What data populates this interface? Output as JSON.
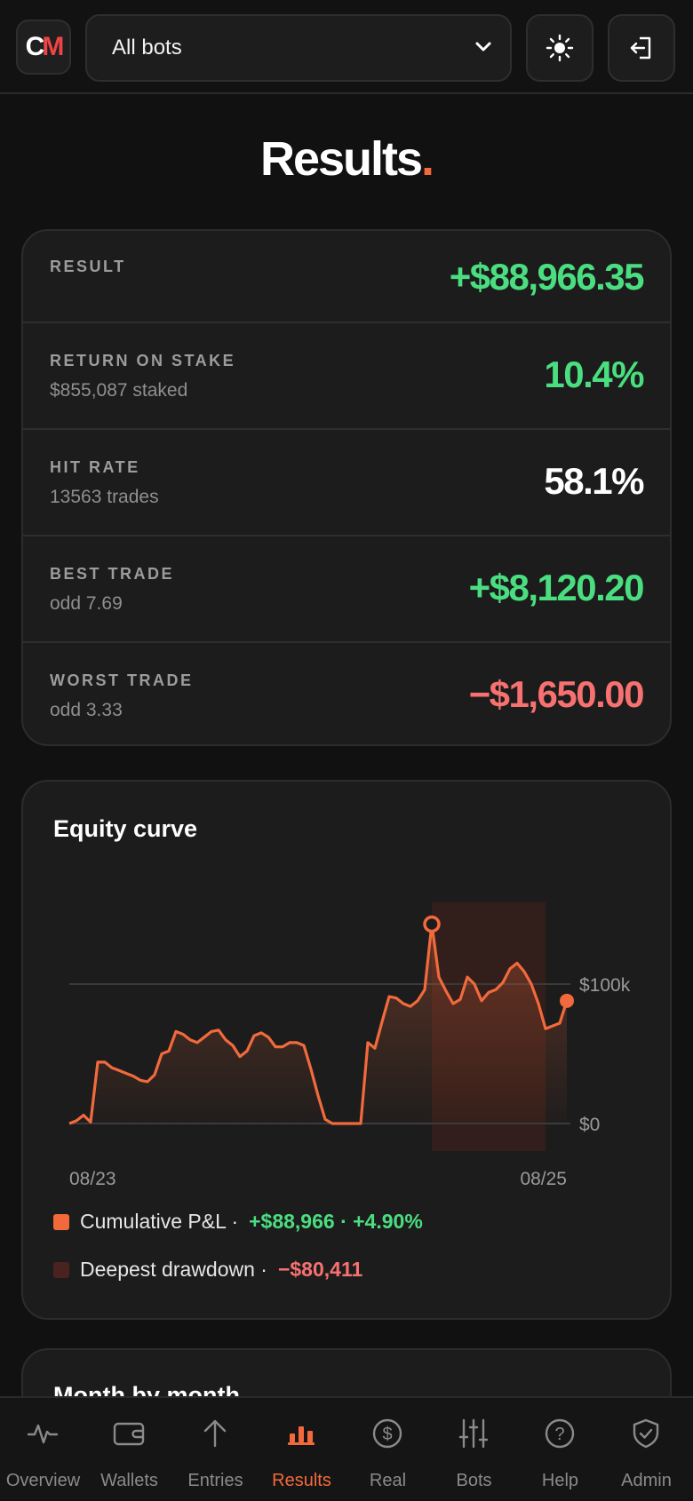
{
  "header": {
    "logo_text_c": "C",
    "logo_text_m": "M",
    "bot_select_value": "All bots",
    "theme_icon": "sun-icon",
    "logout_icon": "logout-icon"
  },
  "page": {
    "title": "Results",
    "title_dot": "."
  },
  "stats": [
    {
      "label": "RESULT",
      "sub": "",
      "value": "+$88,966.35",
      "tone": "pos"
    },
    {
      "label": "RETURN ON STAKE",
      "sub": "$855,087 staked",
      "value": "10.4%",
      "tone": "pos"
    },
    {
      "label": "HIT RATE",
      "sub": "13563 trades",
      "value": "58.1%",
      "tone": "neu"
    },
    {
      "label": "BEST TRADE",
      "sub": "odd 7.69",
      "value": "+$8,120.20",
      "tone": "pos"
    },
    {
      "label": "WORST TRADE",
      "sub": "odd 3.33",
      "value": "−$1,650.00",
      "tone": "neg"
    }
  ],
  "equity": {
    "title": "Equity curve",
    "legend_pnl_label": "Cumulative P&L ·",
    "legend_pnl_value": "+$88,966 · +4.90%",
    "legend_dd_label": "Deepest drawdown ·",
    "legend_dd_value": "−$80,411",
    "colors": {
      "line": "#f26a3c",
      "drawdown": "#3a1f1a",
      "positive": "#4ade80",
      "negative": "#f87171"
    }
  },
  "chart_data": {
    "type": "line",
    "x_tick_labels": [
      "08/23",
      "08/25"
    ],
    "y_tick_labels": [
      "$100k",
      "$0"
    ],
    "y_ticks": [
      100000,
      0
    ],
    "ylim": [
      -15000,
      160000
    ],
    "grid": true,
    "series": [
      {
        "values": [
          0,
          2000,
          6000,
          1000,
          44000,
          44000,
          40000,
          38000,
          36000,
          34000,
          31000,
          30000,
          35000,
          50000,
          52000,
          66000,
          64000,
          60000,
          58000,
          62000,
          66000,
          67000,
          60000,
          56000,
          48000,
          52000,
          63000,
          65000,
          62000,
          55000,
          55000,
          58000,
          58000,
          56000,
          39000,
          20000,
          3000,
          0,
          0,
          0,
          0,
          0,
          58000,
          54000,
          73000,
          91000,
          90000,
          86000,
          84000,
          88000,
          96000,
          112000,
          105000,
          95000,
          86000,
          89000,
          105000,
          100000,
          88000,
          94000,
          96000,
          101000,
          111000,
          115000,
          109000,
          100000,
          86000,
          68000,
          70000,
          72000,
          88000
        ]
      }
    ],
    "peak_index": 51,
    "peak_value": 143000,
    "drawdown_start_index": 51,
    "drawdown_end_index": 67,
    "last_value": 88966
  },
  "nav": [
    {
      "label": "Overview",
      "icon": "activity-icon",
      "active": false
    },
    {
      "label": "Wallets",
      "icon": "wallet-icon",
      "active": false
    },
    {
      "label": "Entries",
      "icon": "arrow-up-icon",
      "active": false
    },
    {
      "label": "Results",
      "icon": "bar-chart-icon",
      "active": true
    },
    {
      "label": "Real",
      "icon": "dollar-circle-icon",
      "active": false
    },
    {
      "label": "Bots",
      "icon": "sliders-icon",
      "active": false
    },
    {
      "label": "Help",
      "icon": "help-circle-icon",
      "active": false
    },
    {
      "label": "Admin",
      "icon": "shield-check-icon",
      "active": false
    }
  ],
  "next_section_title": "Month by month"
}
